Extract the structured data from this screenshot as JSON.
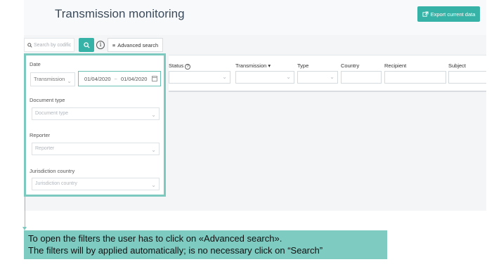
{
  "header": {
    "title": "Transmission monitoring",
    "export_label": "Export current data"
  },
  "toolbar": {
    "search_placeholder": "Search by codific",
    "info_symbol": "i",
    "advanced_label": "Advanced search"
  },
  "columns": [
    {
      "label": "Status",
      "help": "?",
      "kind": "select"
    },
    {
      "label": "Transmission",
      "sort": "▾",
      "kind": "select"
    },
    {
      "label": "Type",
      "kind": "select"
    },
    {
      "label": "Country",
      "kind": "text"
    },
    {
      "label": "Recipient",
      "kind": "text"
    },
    {
      "label": "Subject",
      "kind": "text"
    }
  ],
  "filters": {
    "date": {
      "label": "Date",
      "mode": "Transmission",
      "from": "01/04/2020",
      "separator": "~",
      "to": "01/04/2020"
    },
    "document_type": {
      "label": "Document type",
      "placeholder": "Document type"
    },
    "reporter": {
      "label": "Reporter",
      "placeholder": "Reporter"
    },
    "jurisdiction": {
      "label": "Jurisdiction country",
      "placeholder": "Jurisdiction country"
    }
  },
  "note": {
    "line1": "To open the filters the user has to click on «Advanced search».",
    "line2": "The filters will by applied automatically; is no necessary click on “Search”"
  },
  "colors": {
    "accent": "#36b3a6",
    "highlight": "#7cc9bf",
    "note_bg": "#7dcbc1"
  },
  "icons": {
    "export": "external-link-icon",
    "search": "magnifier-icon",
    "advanced": "list-icon",
    "info": "info-icon",
    "calendar": "calendar-icon"
  }
}
